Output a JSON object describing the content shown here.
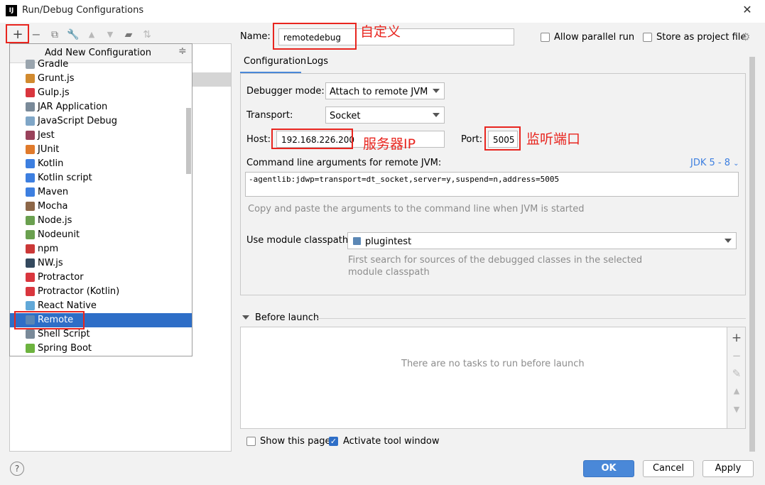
{
  "window": {
    "title": "Run/Debug Configurations",
    "app_icon": "IJ"
  },
  "popup": {
    "title": "Add New Configuration",
    "items": [
      {
        "label": "Gradle",
        "icon": "gradle-icon",
        "color": "#9aa5ae"
      },
      {
        "label": "Grunt.js",
        "icon": "grunt-icon",
        "color": "#d18a2f"
      },
      {
        "label": "Gulp.js",
        "icon": "gulp-icon",
        "color": "#d9363e"
      },
      {
        "label": "JAR Application",
        "icon": "jar-icon",
        "color": "#7a8a99"
      },
      {
        "label": "JavaScript Debug",
        "icon": "js-debug-icon",
        "color": "#7fa6c7"
      },
      {
        "label": "Jest",
        "icon": "jest-icon",
        "color": "#99425b"
      },
      {
        "label": "JUnit",
        "icon": "junit-icon",
        "color": "#e07a2b"
      },
      {
        "label": "Kotlin",
        "icon": "kotlin-icon",
        "color": "#3d7fe0"
      },
      {
        "label": "Kotlin script",
        "icon": "kotlin-script-icon",
        "color": "#3d7fe0"
      },
      {
        "label": "Maven",
        "icon": "maven-icon",
        "color": "#3d7fe0"
      },
      {
        "label": "Mocha",
        "icon": "mocha-icon",
        "color": "#8d6748"
      },
      {
        "label": "Node.js",
        "icon": "nodejs-icon",
        "color": "#6aa04f"
      },
      {
        "label": "Nodeunit",
        "icon": "nodeunit-icon",
        "color": "#6aa04f"
      },
      {
        "label": "npm",
        "icon": "npm-icon",
        "color": "#cb3837"
      },
      {
        "label": "NW.js",
        "icon": "nwjs-icon",
        "color": "#34495e"
      },
      {
        "label": "Protractor",
        "icon": "protractor-icon",
        "color": "#d9363e"
      },
      {
        "label": "Protractor (Kotlin)",
        "icon": "protractor-kotlin-icon",
        "color": "#d9363e"
      },
      {
        "label": "React Native",
        "icon": "react-icon",
        "color": "#61a8d8"
      },
      {
        "label": "Remote",
        "icon": "remote-icon",
        "color": "#5b87b5"
      },
      {
        "label": "Shell Script",
        "icon": "shell-icon",
        "color": "#7a8a99"
      },
      {
        "label": "Spring Boot",
        "icon": "spring-boot-icon",
        "color": "#6db33f"
      }
    ],
    "selected_index": 18
  },
  "form": {
    "name_label": "Name:",
    "name_value": "remotedebug",
    "allow_parallel_label": "Allow parallel run",
    "store_as_project_label": "Store as project file",
    "tabs": [
      "Configuration",
      "Logs"
    ],
    "debugger_mode_label": "Debugger mode:",
    "debugger_mode_value": "Attach to remote JVM",
    "transport_label": "Transport:",
    "transport_value": "Socket",
    "host_label": "Host:",
    "host_value": "192.168.226.200",
    "port_label": "Port:",
    "port_value": "5005",
    "cmdline_label": "Command line arguments for remote JVM:",
    "jdk_link": "JDK 5 - 8",
    "cmdline_value": "-agentlib:jdwp=transport=dt_socket,server=y,suspend=n,address=5005",
    "cmdline_hint": "Copy and paste the arguments to the command line when JVM is started",
    "module_label": "Use module classpath:",
    "module_value": "plugintest",
    "module_hint_1": "First search for sources of the debugged classes in the selected",
    "module_hint_2": "module classpath"
  },
  "before_launch": {
    "title": "Before launch",
    "empty_text": "There are no tasks to run before launch"
  },
  "footer": {
    "show_page_label": "Show this page",
    "activate_tool_label": "Activate tool window",
    "ok_label": "OK",
    "cancel_label": "Cancel",
    "apply_label": "Apply",
    "help": "?"
  },
  "annotations": {
    "custom_name": "自定义",
    "server_ip": "服务器IP",
    "listen_port": "监听端口"
  },
  "colors": {
    "accent": "#4a88d8",
    "highlight": "#e8251f",
    "selection": "#2e6ec7"
  }
}
